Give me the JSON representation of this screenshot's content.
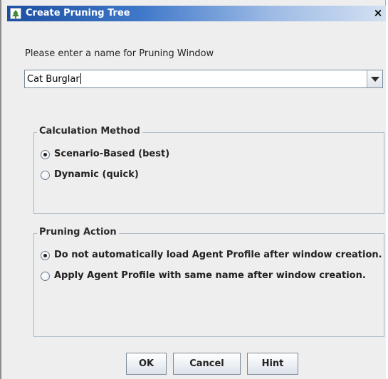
{
  "window": {
    "title": "Create Pruning Tree",
    "close_glyph": "×",
    "icon": "tree-app-icon"
  },
  "form": {
    "prompt": "Please enter a name for Pruning Window",
    "name_value": "Cat Burglar"
  },
  "calculation_method": {
    "legend": "Calculation Method",
    "options": [
      {
        "label": "Scenario-Based (best)",
        "selected": true
      },
      {
        "label": "Dynamic (quick)",
        "selected": false
      }
    ]
  },
  "pruning_action": {
    "legend": "Pruning Action",
    "options": [
      {
        "label": "Do not automatically load Agent Profile after window creation.",
        "selected": true
      },
      {
        "label": "Apply Agent Profile with same name after window creation.",
        "selected": false
      }
    ]
  },
  "buttons": {
    "ok": "OK",
    "cancel": "Cancel",
    "hint": "Hint"
  }
}
